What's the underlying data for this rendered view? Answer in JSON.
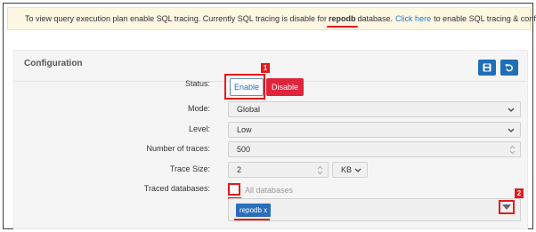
{
  "alert": {
    "text_before": "To view query execution plan enable SQL tracing. Currently SQL tracing is disable for",
    "db_name": "repodb",
    "text_middle": "database.",
    "link_text": "Click here",
    "text_after": "to enable SQL tracing & configure."
  },
  "config": {
    "title": "Configuration",
    "icons": {
      "save": "save-icon",
      "undo": "undo-icon"
    },
    "status": {
      "label": "Status:",
      "enable_label": "Enable",
      "disable_label": "Disable",
      "selected": "Enable"
    },
    "mode": {
      "label": "Mode:",
      "value": "Global"
    },
    "level": {
      "label": "Level:",
      "value": "Low"
    },
    "traces": {
      "label": "Number of traces:",
      "value": "500"
    },
    "trace_size": {
      "label": "Trace Size:",
      "value": "2",
      "unit": "KB"
    },
    "traced_databases": {
      "label": "Traced databases:",
      "all_label": "All databases",
      "all_checked": false,
      "tags": [
        "repodb x"
      ]
    }
  },
  "annotations": {
    "badge1": "1",
    "badge2": "2"
  },
  "colors": {
    "accent": "#1f6fb8",
    "danger": "#e0243b",
    "highlight": "#e31b1b",
    "link": "#1f7ac7"
  }
}
